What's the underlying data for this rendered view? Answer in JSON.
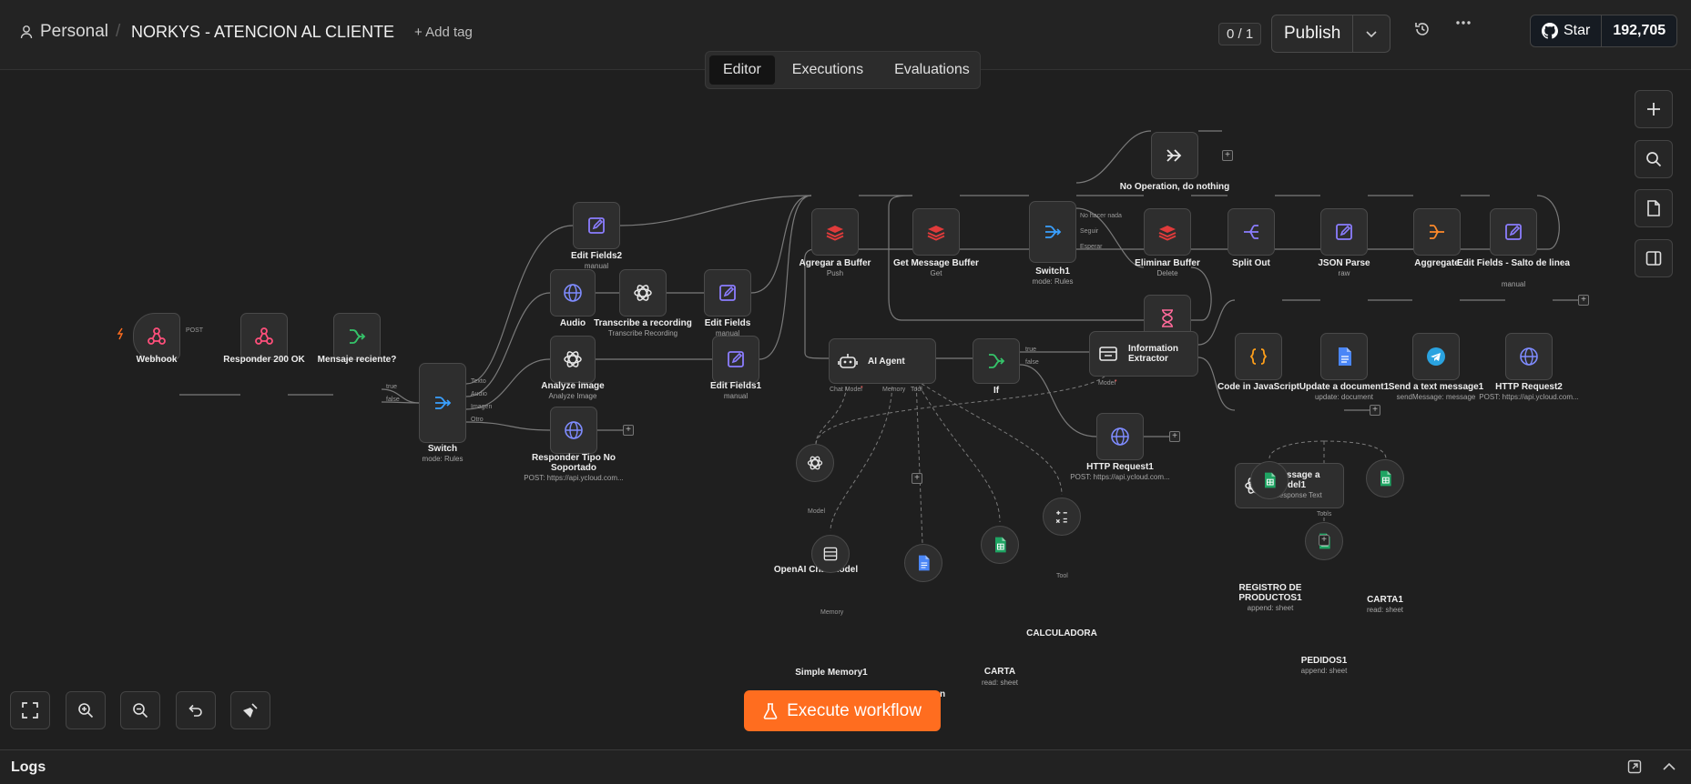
{
  "header": {
    "project": "Personal",
    "separator": "/",
    "workflow_title": "NORKYS - ATENCION AL CLIENTE",
    "add_tag": "+ Add tag",
    "version_count": "0 / 1",
    "publish_label": "Publish",
    "github_star_label": "Star",
    "github_star_count": "192,705"
  },
  "tabs": [
    {
      "label": "Editor",
      "active": true
    },
    {
      "label": "Executions"
    },
    {
      "label": "Evaluations"
    }
  ],
  "nodes": {
    "webhook": {
      "label": "Webhook"
    },
    "responder200": {
      "label": "Responder 200 OK"
    },
    "mensaje": {
      "label": "Mensaje reciente?"
    },
    "switch": {
      "label": "Switch",
      "sub": "mode: Rules"
    },
    "editfields2": {
      "label": "Edit Fields2",
      "sub": "manual"
    },
    "audio": {
      "label": "Audio"
    },
    "transcribe": {
      "label": "Transcribe a recording",
      "sub": "Transcribe Recording"
    },
    "editfields": {
      "label": "Edit Fields",
      "sub": "manual"
    },
    "analyze": {
      "label": "Analyze image",
      "sub": "Analyze Image"
    },
    "editfields1": {
      "label": "Edit Fields1",
      "sub": "manual"
    },
    "responderno": {
      "label": "Responder Tipo No Soportado",
      "sub": "POST: https://api.ycloud.com..."
    },
    "agregar": {
      "label": "Agregar a Buffer",
      "sub": "Push"
    },
    "getbuffer": {
      "label": "Get Message Buffer",
      "sub": "Get"
    },
    "switch1": {
      "label": "Switch1",
      "sub": "mode: Rules"
    },
    "noop": {
      "label": "No Operation, do nothing"
    },
    "eliminar": {
      "label": "Eliminar Buffer",
      "sub": "Delete"
    },
    "splitout": {
      "label": "Split Out"
    },
    "jsonparse": {
      "label": "JSON Parse",
      "sub": "raw"
    },
    "aggregate": {
      "label": "Aggregate"
    },
    "editsalto": {
      "label": "Edit Fields - Salto de linea",
      "sub": "manual"
    },
    "wait2": {
      "label": "Wait2"
    },
    "aiagent": {
      "label": "AI Agent"
    },
    "if": {
      "label": "If"
    },
    "infoextractor": {
      "label": "Information Extractor"
    },
    "code": {
      "label": "Code in JavaScript"
    },
    "updatedoc": {
      "label": "Update a document1",
      "sub": "update: document"
    },
    "sendtext": {
      "label": "Send a text message1",
      "sub": "sendMessage: message"
    },
    "httpreq2": {
      "label": "HTTP Request2",
      "sub": "POST: https://api.ycloud.com..."
    },
    "messagemodel": {
      "label": "Message a model1",
      "sub": "Response Text"
    },
    "httpreq1": {
      "label": "HTTP Request1",
      "sub": "POST: https://api.ycloud.com..."
    },
    "openai": {
      "label": "OpenAI Chat Model"
    },
    "memory": {
      "label": "Simple Memory1"
    },
    "docpartial": {
      "label": "n"
    },
    "carta": {
      "label": "CARTA",
      "sub": "read: sheet"
    },
    "calculadora": {
      "label": "CALCULADORA"
    },
    "registro": {
      "label": "REGISTRO DE PRODUCTOS1",
      "sub": "append: sheet"
    },
    "pedidos": {
      "label": "PEDIDOS1",
      "sub": "append: sheet"
    },
    "carta1": {
      "label": "CARTA1",
      "sub": "read: sheet"
    }
  },
  "ports": {
    "post": "POST",
    "true": "true",
    "false": "false",
    "texto": "Texto",
    "audio": "Audio",
    "imagen": "Imagen",
    "otro": "Otro",
    "nohacer": "No hacer nada",
    "seguir": "Seguir",
    "esperar": "Esperar",
    "chatmodel": "Chat Model",
    "memory": "Memory",
    "tool": "Tool",
    "model": "Model",
    "tools": "Tools",
    "asterisk": "*"
  },
  "execute_label": "Execute workflow",
  "logs_label": "Logs",
  "colors": {
    "accent": "#ff6d1f",
    "canvas": "#1f1f1f",
    "node": "#2e2e2e"
  }
}
